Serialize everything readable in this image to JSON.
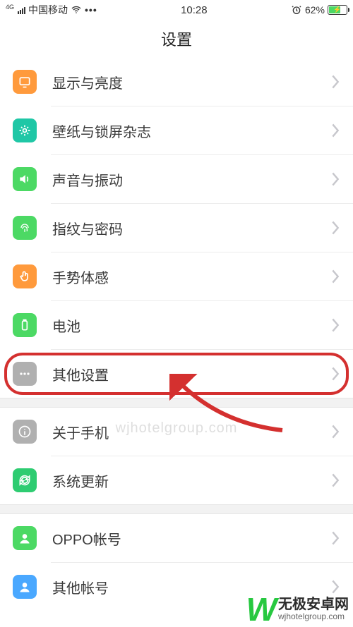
{
  "status": {
    "net_superscript": "4G",
    "carrier": "中国移动",
    "dots": "•••",
    "time": "10:28",
    "battery_pct": "62%"
  },
  "title": "设置",
  "sections": [
    {
      "rows": [
        {
          "label": "显示与亮度",
          "icon": "display-icon"
        },
        {
          "label": "壁纸与锁屏杂志",
          "icon": "wallpaper-icon"
        },
        {
          "label": "声音与振动",
          "icon": "sound-icon"
        },
        {
          "label": "指纹与密码",
          "icon": "fingerprint-icon"
        },
        {
          "label": "手势体感",
          "icon": "gesture-icon"
        },
        {
          "label": "电池",
          "icon": "battery-icon"
        },
        {
          "label": "其他设置",
          "icon": "other-icon",
          "highlighted": true
        }
      ]
    },
    {
      "rows": [
        {
          "label": "关于手机",
          "icon": "about-icon"
        },
        {
          "label": "系统更新",
          "icon": "update-icon"
        }
      ]
    },
    {
      "rows": [
        {
          "label": "OPPO帐号",
          "icon": "oppo-account-icon"
        },
        {
          "label": "其他帐号",
          "icon": "other-account-icon"
        }
      ]
    }
  ],
  "watermark_center": "wjhotelgroup.com",
  "brand": {
    "logo_text": "W",
    "line1": "无极安卓网",
    "line2": "wjhotelgroup.com"
  },
  "colors": {
    "highlight": "#d4302f",
    "accent_green": "#4cd964",
    "accent_orange": "#ff9a3c"
  }
}
